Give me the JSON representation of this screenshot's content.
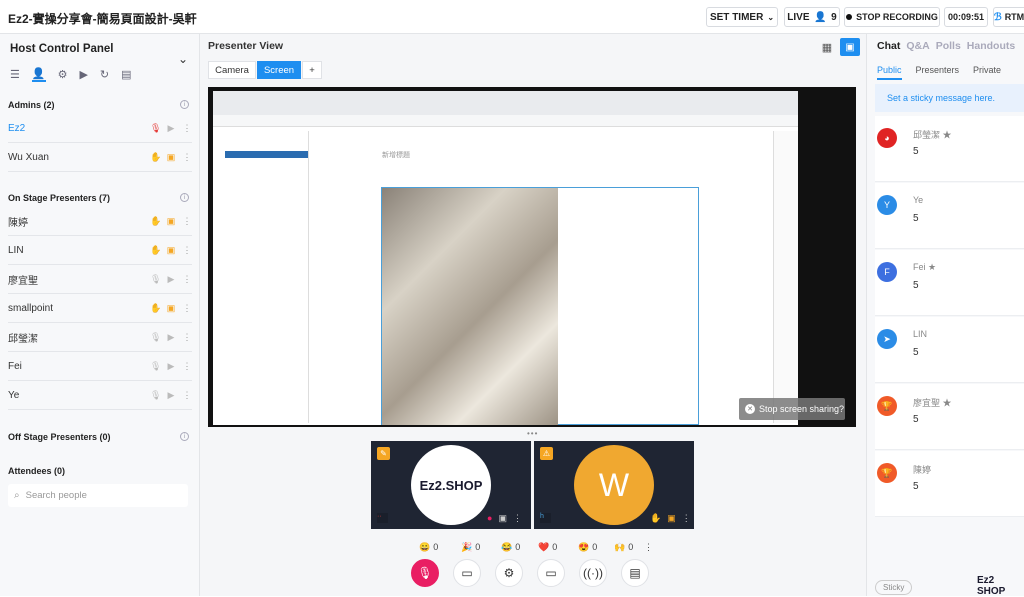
{
  "header": {
    "event_title": "Ez2-實操分享會-簡易頁面設計-吳軒",
    "set_timer": "SET TIMER",
    "live": "LIVE",
    "viewer_count": "9",
    "stop_recording": "STOP RECORDING",
    "timer": "00:09:51",
    "rtm": "RTM"
  },
  "left_panel": {
    "title": "Host Control Panel",
    "admins_heading": "Admins (2)",
    "admins": [
      {
        "name": "Ez2",
        "active": true
      },
      {
        "name": "Wu Xuan",
        "active": false
      }
    ],
    "on_stage_heading": "On Stage Presenters (7)",
    "on_stage": [
      {
        "name": "陳婷",
        "muted": false
      },
      {
        "name": "LIN",
        "muted": false
      },
      {
        "name": "廖宜聖",
        "muted": true
      },
      {
        "name": "smallpoint",
        "muted": false
      },
      {
        "name": "邱瑩潔",
        "muted": true
      },
      {
        "name": "Fei",
        "muted": true
      },
      {
        "name": "Ye",
        "muted": true
      }
    ],
    "off_stage_heading": "Off Stage Presenters (0)",
    "attendees_heading": "Attendees (0)",
    "search_placeholder": "Search people"
  },
  "center": {
    "title": "Presenter View",
    "tab_camera": "Camera",
    "tab_screen": "Screen",
    "tab_add": "+",
    "screen_doc_title": "新增標題",
    "stop_sharing": "Stop screen sharing?",
    "logo_text": "Ez2.SHOP",
    "avatar_letter": "W",
    "reactions": [
      {
        "emoji": "😀",
        "count": "0"
      },
      {
        "emoji": "🎉",
        "count": "0"
      },
      {
        "emoji": "😂",
        "count": "0"
      },
      {
        "emoji": "❤️",
        "count": "0"
      },
      {
        "emoji": "😍",
        "count": "0"
      },
      {
        "emoji": "🙌",
        "count": "0"
      }
    ]
  },
  "right_panel": {
    "tabs": [
      "Chat",
      "Q&A",
      "Polls",
      "Handouts"
    ],
    "subtabs": [
      "Public",
      "Presenters",
      "Private"
    ],
    "sticky_prompt": "Set a sticky message here.",
    "messages": [
      {
        "name": "邱瑩潔 ★",
        "text": "5",
        "color": "#e02424",
        "initial": "◕"
      },
      {
        "name": "Ye",
        "text": "5",
        "color": "#2b8ce6",
        "initial": "Y"
      },
      {
        "name": "Fei ★",
        "text": "5",
        "color": "#3d6fe0",
        "initial": "F"
      },
      {
        "name": "LIN",
        "text": "5",
        "color": "#2b8ce6",
        "initial": "➤"
      },
      {
        "name": "廖宜聖 ★",
        "text": "5",
        "color": "#f05a28",
        "initial": "🏆"
      },
      {
        "name": "陳婷",
        "text": "5",
        "color": "#f05a28",
        "initial": "🏆"
      }
    ],
    "sticky_label": "Sticky",
    "brand": "Ez2 SHOP"
  },
  "colors": {
    "accent": "#1e8ef0",
    "record_bg": "#111111",
    "mic_red": "#e53935",
    "hand_orange": "#f5a623",
    "control_pink": "#e91e63"
  }
}
